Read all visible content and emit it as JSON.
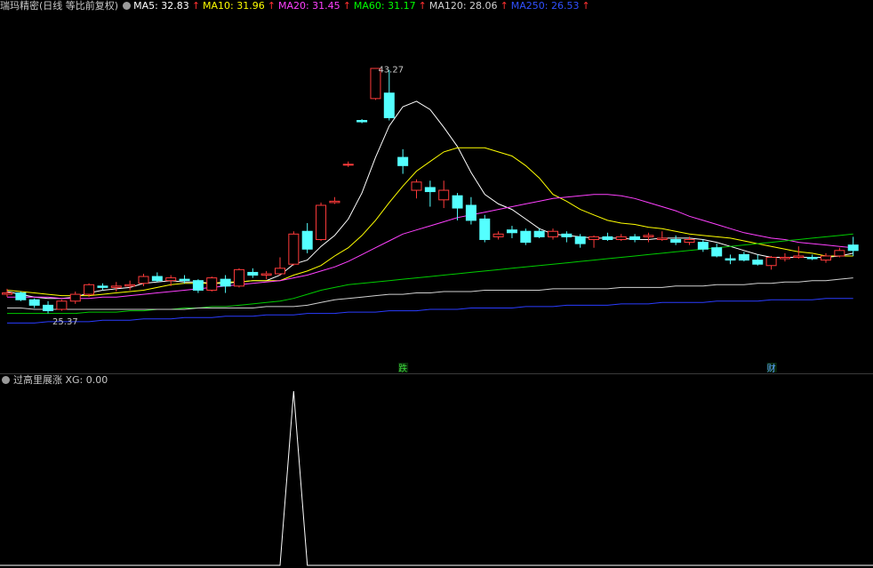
{
  "header": {
    "title": "瑞玛精密(日线 等比前复权)",
    "ma": [
      {
        "label": "MA5: 32.83",
        "color": "#ffffff"
      },
      {
        "label": "MA10: 31.96",
        "color": "#ffff00"
      },
      {
        "label": "MA20: 31.45",
        "color": "#ff40ff"
      },
      {
        "label": "MA60: 31.17",
        "color": "#00ff00"
      },
      {
        "label": "MA120: 28.06",
        "color": "#d0d0d0"
      },
      {
        "label": "MA250: 26.53",
        "color": "#3050ff"
      }
    ],
    "arrow": "↑"
  },
  "indicator": {
    "title": "过高里展涨",
    "label": "XG: 0.00"
  },
  "chart_data": {
    "type": "candlestick",
    "price_range": [
      22,
      47
    ],
    "annotations": {
      "high": "43.27",
      "low": "25.37",
      "event1": "跌",
      "event2": "财"
    },
    "candles": [
      [
        26.8,
        27.2,
        26.6,
        26.9
      ],
      [
        26.9,
        27.0,
        26.3,
        26.4
      ],
      [
        26.4,
        26.5,
        25.8,
        26.0
      ],
      [
        26.0,
        26.3,
        25.4,
        25.6
      ],
      [
        25.7,
        26.4,
        25.6,
        26.3
      ],
      [
        26.3,
        27.0,
        26.1,
        26.8
      ],
      [
        26.8,
        27.6,
        26.6,
        27.5
      ],
      [
        27.4,
        27.6,
        27.1,
        27.3
      ],
      [
        27.3,
        27.7,
        27.0,
        27.4
      ],
      [
        27.4,
        27.8,
        27.1,
        27.5
      ],
      [
        27.6,
        28.3,
        27.4,
        28.1
      ],
      [
        28.1,
        28.4,
        27.7,
        27.8
      ],
      [
        27.8,
        28.2,
        27.4,
        28.0
      ],
      [
        27.9,
        28.2,
        27.6,
        27.8
      ],
      [
        27.8,
        27.9,
        26.9,
        27.1
      ],
      [
        27.1,
        28.1,
        27.0,
        28.0
      ],
      [
        27.9,
        28.2,
        26.9,
        27.4
      ],
      [
        27.4,
        28.7,
        27.3,
        28.6
      ],
      [
        28.4,
        28.7,
        28.0,
        28.2
      ],
      [
        28.2,
        28.5,
        27.9,
        28.3
      ],
      [
        28.3,
        29.5,
        28.2,
        28.7
      ],
      [
        29.0,
        31.4,
        28.9,
        31.2
      ],
      [
        31.4,
        32.0,
        29.8,
        30.1
      ],
      [
        30.8,
        33.5,
        30.7,
        33.3
      ],
      [
        33.5,
        33.9,
        33.4,
        33.6
      ],
      [
        36.3,
        36.5,
        36.1,
        36.3
      ],
      [
        39.5,
        39.6,
        39.3,
        39.4
      ],
      [
        41.1,
        43.3,
        41.0,
        43.3
      ],
      [
        41.5,
        43.2,
        39.5,
        39.7
      ],
      [
        36.8,
        37.4,
        35.6,
        36.2
      ],
      [
        34.4,
        35.2,
        33.8,
        35.0
      ],
      [
        34.6,
        35.1,
        33.2,
        34.3
      ],
      [
        33.7,
        35.1,
        33.1,
        34.4
      ],
      [
        34.0,
        34.2,
        32.2,
        33.1
      ],
      [
        33.3,
        33.9,
        31.9,
        32.2
      ],
      [
        32.3,
        32.6,
        30.6,
        30.8
      ],
      [
        31.0,
        31.4,
        30.8,
        31.2
      ],
      [
        31.5,
        31.8,
        30.9,
        31.3
      ],
      [
        31.4,
        31.6,
        30.4,
        30.6
      ],
      [
        31.4,
        31.6,
        30.9,
        31.0
      ],
      [
        31.0,
        31.6,
        30.8,
        31.4
      ],
      [
        31.2,
        31.4,
        30.6,
        31.0
      ],
      [
        31.0,
        31.2,
        30.2,
        30.5
      ],
      [
        30.8,
        31.1,
        30.2,
        31.0
      ],
      [
        31.0,
        31.3,
        30.7,
        30.8
      ],
      [
        30.8,
        31.2,
        30.7,
        31.0
      ],
      [
        31.0,
        31.2,
        30.6,
        30.8
      ],
      [
        31.0,
        31.3,
        30.6,
        31.1
      ],
      [
        30.8,
        31.4,
        30.7,
        30.9
      ],
      [
        30.8,
        31.1,
        30.4,
        30.6
      ],
      [
        30.6,
        31.0,
        30.4,
        30.8
      ],
      [
        30.6,
        30.8,
        29.9,
        30.1
      ],
      [
        30.2,
        30.5,
        29.5,
        29.6
      ],
      [
        29.4,
        29.7,
        29.0,
        29.3
      ],
      [
        29.7,
        29.9,
        29.2,
        29.3
      ],
      [
        29.3,
        29.7,
        28.9,
        29.0
      ],
      [
        28.9,
        29.6,
        28.6,
        29.5
      ],
      [
        29.4,
        29.8,
        29.2,
        29.5
      ],
      [
        29.5,
        30.3,
        29.4,
        29.6
      ],
      [
        29.5,
        29.7,
        29.3,
        29.4
      ],
      [
        29.3,
        29.8,
        29.1,
        29.6
      ],
      [
        29.6,
        30.2,
        29.5,
        30.0
      ],
      [
        30.4,
        31.0,
        29.6,
        30.0
      ]
    ],
    "ma_series": {
      "MA5": [
        27.0,
        26.8,
        26.6,
        26.5,
        26.5,
        26.6,
        26.9,
        27.1,
        27.2,
        27.3,
        27.6,
        27.7,
        27.8,
        27.7,
        27.7,
        27.6,
        27.6,
        27.7,
        27.8,
        27.8,
        28.2,
        29.0,
        29.3,
        30.3,
        31.1,
        32.3,
        34.2,
        36.8,
        39.1,
        40.5,
        40.9,
        40.3,
        39.0,
        37.6,
        35.7,
        34.1,
        33.4,
        33.0,
        32.3,
        31.6,
        31.2,
        31.1,
        31.0,
        30.9,
        30.9,
        30.9,
        30.8,
        30.8,
        30.9,
        30.9,
        30.9,
        30.8,
        30.6,
        30.3,
        30.0,
        29.7,
        29.5,
        29.5,
        29.5,
        29.5,
        29.5,
        29.6,
        29.8
      ],
      "MA10": [
        27.1,
        27.0,
        26.9,
        26.8,
        26.7,
        26.7,
        26.7,
        26.8,
        26.9,
        27.0,
        27.1,
        27.3,
        27.5,
        27.6,
        27.6,
        27.6,
        27.7,
        27.7,
        27.8,
        27.8,
        27.8,
        28.2,
        28.5,
        28.9,
        29.6,
        30.2,
        31.1,
        32.2,
        33.5,
        34.7,
        35.8,
        36.5,
        37.2,
        37.5,
        37.5,
        37.5,
        37.2,
        36.9,
        36.2,
        35.3,
        34.1,
        33.6,
        33.0,
        32.6,
        32.2,
        32.0,
        31.9,
        31.7,
        31.6,
        31.4,
        31.2,
        31.1,
        31.0,
        30.9,
        30.7,
        30.5,
        30.3,
        30.1,
        29.9,
        29.8,
        29.6,
        29.6,
        29.6
      ],
      "MA20": [
        26.6,
        26.6,
        26.6,
        26.6,
        26.5,
        26.5,
        26.5,
        26.6,
        26.6,
        26.7,
        26.8,
        26.9,
        27.0,
        27.1,
        27.2,
        27.3,
        27.4,
        27.5,
        27.6,
        27.7,
        27.8,
        28.0,
        28.2,
        28.5,
        28.8,
        29.2,
        29.7,
        30.2,
        30.7,
        31.2,
        31.5,
        31.8,
        32.1,
        32.4,
        32.6,
        32.8,
        33.0,
        33.2,
        33.4,
        33.6,
        33.8,
        33.9,
        34.0,
        34.1,
        34.1,
        34.0,
        33.8,
        33.5,
        33.2,
        32.9,
        32.5,
        32.2,
        31.9,
        31.6,
        31.3,
        31.1,
        30.9,
        30.8,
        30.6,
        30.5,
        30.4,
        30.3,
        30.2
      ],
      "MA60": [
        25.4,
        25.4,
        25.4,
        25.4,
        25.4,
        25.4,
        25.5,
        25.5,
        25.5,
        25.6,
        25.6,
        25.7,
        25.7,
        25.8,
        25.8,
        25.9,
        25.9,
        26.0,
        26.1,
        26.2,
        26.3,
        26.5,
        26.8,
        27.1,
        27.3,
        27.5,
        27.6,
        27.7,
        27.8,
        27.9,
        28.0,
        28.1,
        28.2,
        28.3,
        28.4,
        28.5,
        28.6,
        28.7,
        28.8,
        28.9,
        29.0,
        29.1,
        29.2,
        29.3,
        29.4,
        29.5,
        29.6,
        29.7,
        29.8,
        29.9,
        30.0,
        30.1,
        30.2,
        30.3,
        30.4,
        30.5,
        30.6,
        30.7,
        30.8,
        30.9,
        31.0,
        31.1,
        31.2
      ],
      "MA120": [
        25.8,
        25.8,
        25.7,
        25.7,
        25.7,
        25.7,
        25.7,
        25.7,
        25.7,
        25.7,
        25.7,
        25.7,
        25.7,
        25.7,
        25.8,
        25.8,
        25.8,
        25.8,
        25.8,
        25.9,
        25.9,
        25.9,
        26.0,
        26.2,
        26.4,
        26.5,
        26.6,
        26.7,
        26.8,
        26.8,
        26.9,
        26.9,
        27.0,
        27.0,
        27.0,
        27.1,
        27.1,
        27.1,
        27.1,
        27.1,
        27.2,
        27.2,
        27.2,
        27.2,
        27.2,
        27.3,
        27.3,
        27.3,
        27.3,
        27.4,
        27.4,
        27.4,
        27.5,
        27.5,
        27.5,
        27.6,
        27.6,
        27.7,
        27.7,
        27.8,
        27.8,
        27.9,
        28.0
      ],
      "MA250": [
        24.7,
        24.7,
        24.7,
        24.8,
        24.8,
        24.8,
        24.8,
        24.9,
        24.9,
        24.9,
        25.0,
        25.0,
        25.0,
        25.1,
        25.1,
        25.1,
        25.2,
        25.2,
        25.2,
        25.3,
        25.3,
        25.3,
        25.4,
        25.4,
        25.4,
        25.5,
        25.5,
        25.5,
        25.6,
        25.6,
        25.6,
        25.7,
        25.7,
        25.7,
        25.8,
        25.8,
        25.8,
        25.8,
        25.9,
        25.9,
        25.9,
        26.0,
        26.0,
        26.0,
        26.0,
        26.1,
        26.1,
        26.1,
        26.2,
        26.2,
        26.2,
        26.2,
        26.3,
        26.3,
        26.3,
        26.3,
        26.4,
        26.4,
        26.4,
        26.4,
        26.5,
        26.5,
        26.5
      ]
    },
    "xg_signal": [
      0,
      0,
      0,
      0,
      0,
      0,
      0,
      0,
      0,
      0,
      0,
      0,
      0,
      0,
      0,
      0,
      0,
      0,
      0,
      0,
      0,
      1,
      0,
      0,
      0,
      0,
      0,
      0,
      0,
      0,
      0,
      0,
      0,
      0,
      0,
      0,
      0,
      0,
      0,
      0,
      0,
      0,
      0,
      0,
      0,
      0,
      0,
      0,
      0,
      0,
      0,
      0,
      0,
      0,
      0,
      0,
      0,
      0,
      0,
      0,
      0,
      0,
      0
    ]
  }
}
